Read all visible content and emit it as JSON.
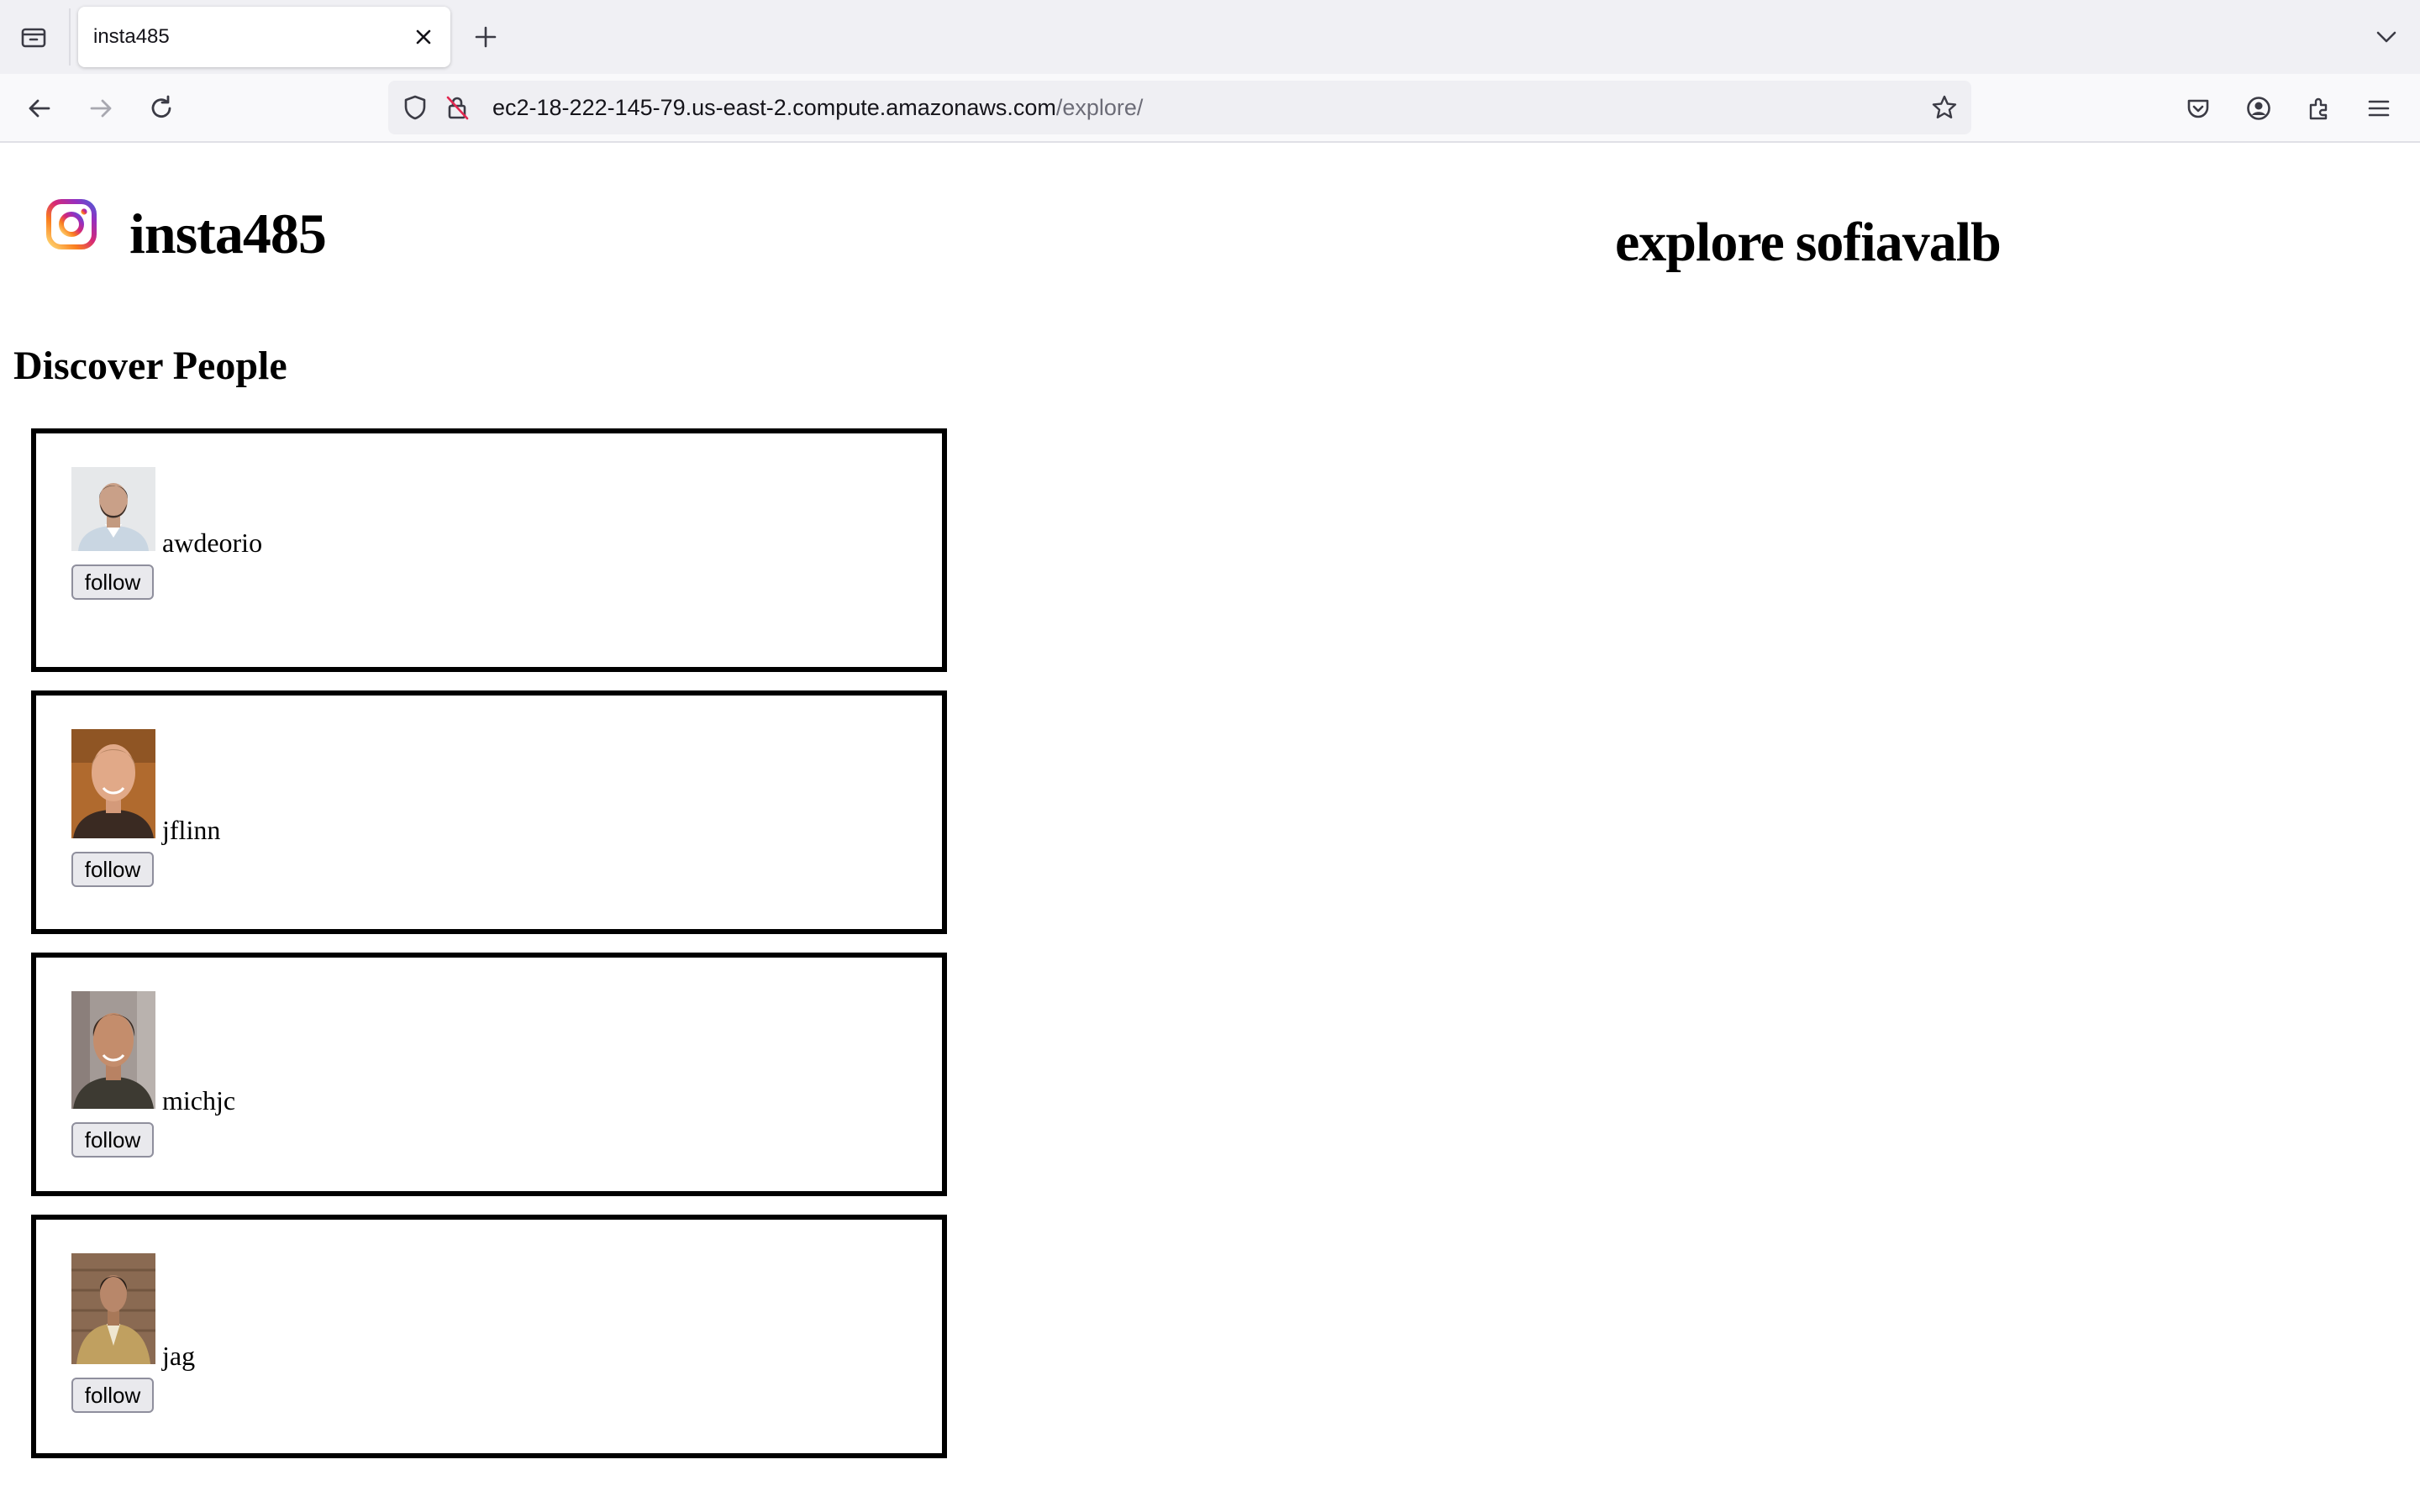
{
  "browser": {
    "tab_title": "insta485",
    "url_host": "ec2-18-222-145-79.us-east-2.compute.amazonaws.com",
    "url_path": "/explore/",
    "icons": {
      "tab_overview": "tab-overview-icon",
      "tab_close": "close-icon",
      "new_tab": "plus-icon",
      "tab_list": "chevron-down-icon",
      "back": "arrow-left-icon",
      "forward": "arrow-right-icon",
      "reload": "reload-icon",
      "shield": "shield-icon",
      "lock": "insecure-lock-icon",
      "bookmark": "star-icon",
      "pocket": "pocket-icon",
      "account": "account-icon",
      "extensions": "puzzle-icon",
      "menu": "hamburger-menu-icon"
    }
  },
  "header": {
    "site_title": "insta485",
    "explore_link": "explore",
    "user_link": "sofiavalb"
  },
  "discover": {
    "title": "Discover People",
    "people": [
      {
        "username": "awdeorio",
        "follow_label": "follow"
      },
      {
        "username": "jflinn",
        "follow_label": "follow"
      },
      {
        "username": "michjc",
        "follow_label": "follow"
      },
      {
        "username": "jag",
        "follow_label": "follow"
      }
    ]
  },
  "colors": {
    "tabbar_bg": "#f0f0f4",
    "navbar_bg": "#f9f9fb",
    "urlbar_bg": "#efeff3",
    "card_border": "#000000",
    "button_bg": "#e9e9ed",
    "url_path_gray": "#6c6c77",
    "logo_gradient": [
      "#feda75",
      "#fa7e1e",
      "#d62976",
      "#962fbf",
      "#4f5bd5"
    ]
  }
}
